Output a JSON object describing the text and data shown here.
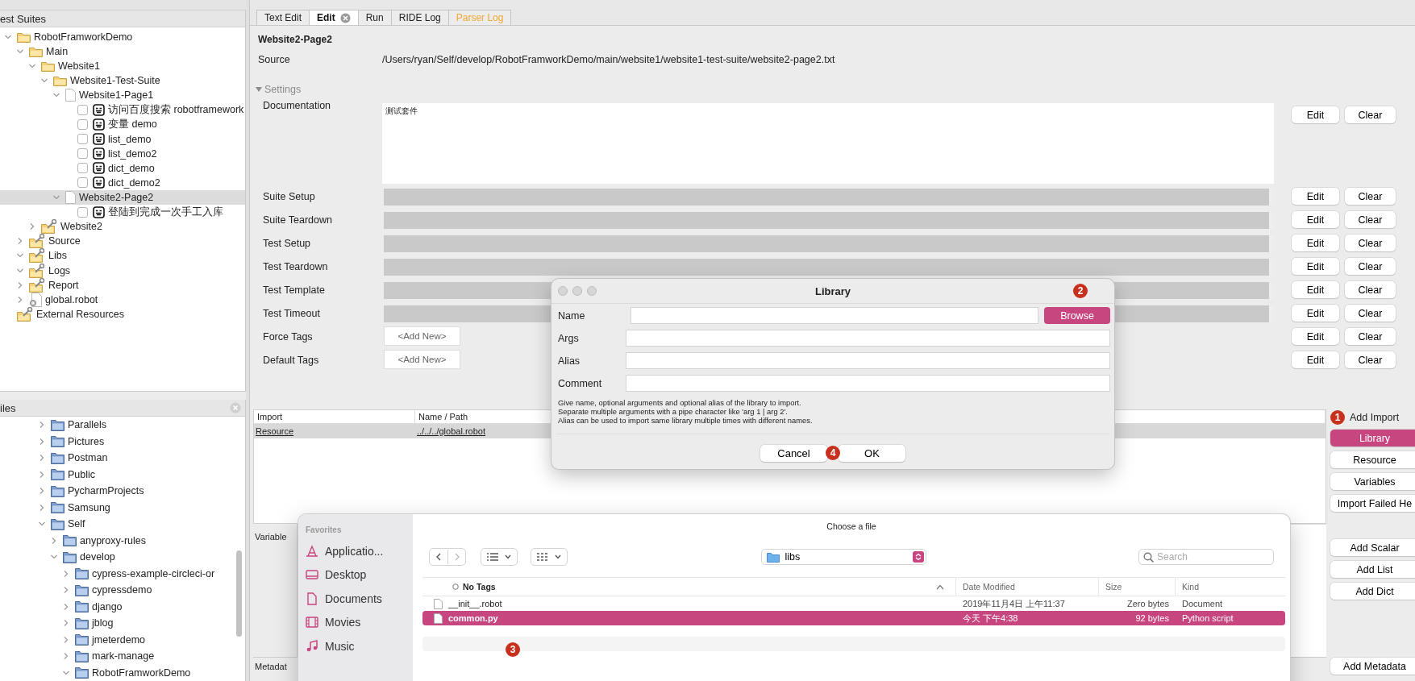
{
  "test_suites": {
    "title": "est Suites",
    "tree": [
      {
        "label": "RobotFramworkDemo",
        "kind": "suite-folder",
        "expanded": true,
        "selected": false,
        "children": [
          {
            "label": "Main",
            "kind": "suite-folder",
            "expanded": true,
            "selected": false,
            "children": [
              {
                "label": "Website1",
                "kind": "suite-folder",
                "expanded": true,
                "selected": false,
                "children": [
                  {
                    "label": "Website1-Test-Suite",
                    "kind": "suite-folder",
                    "expanded": true,
                    "selected": false,
                    "children": [
                      {
                        "label": "Website1-Page1",
                        "kind": "suite-file",
                        "expanded": true,
                        "selected": false,
                        "children": [
                          {
                            "label": "访问百度搜索 robotframework",
                            "kind": "test",
                            "checked": false,
                            "selected": false
                          },
                          {
                            "label": "变量 demo",
                            "kind": "test",
                            "checked": false,
                            "selected": false
                          },
                          {
                            "label": "list_demo",
                            "kind": "test",
                            "checked": false,
                            "selected": false
                          },
                          {
                            "label": "list_demo2",
                            "kind": "test",
                            "checked": false,
                            "selected": false
                          },
                          {
                            "label": "dict_demo",
                            "kind": "test",
                            "checked": false,
                            "selected": false
                          },
                          {
                            "label": "dict_demo2",
                            "kind": "test",
                            "checked": false,
                            "selected": false
                          }
                        ]
                      },
                      {
                        "label": "Website2-Page2",
                        "kind": "suite-file",
                        "expanded": true,
                        "selected": true,
                        "children": [
                          {
                            "label": "登陆到完成一次手工入库",
                            "kind": "test",
                            "checked": false,
                            "selected": false
                          }
                        ]
                      }
                    ]
                  }
                ]
              },
              {
                "label": "Website2",
                "kind": "resource-folder",
                "expanded": false,
                "selected": false
              }
            ]
          },
          {
            "label": "Source",
            "kind": "resource-folder",
            "expanded": false,
            "selected": false
          },
          {
            "label": "Libs",
            "kind": "resource-folder",
            "expanded": true,
            "selected": false
          },
          {
            "label": "Logs",
            "kind": "resource-folder",
            "expanded": true,
            "selected": false
          },
          {
            "label": "Report",
            "kind": "resource-folder",
            "expanded": false,
            "selected": false
          },
          {
            "label": "global.robot",
            "kind": "resource-file",
            "expanded": false,
            "selected": false
          }
        ]
      },
      {
        "label": "External Resources",
        "kind": "resource-folder",
        "selected": false
      }
    ]
  },
  "files": {
    "title": "iles",
    "tree": [
      {
        "label": "Parallels",
        "kind": "folder",
        "expanded": false
      },
      {
        "label": "Pictures",
        "kind": "folder",
        "expanded": false
      },
      {
        "label": "Postman",
        "kind": "folder",
        "expanded": false
      },
      {
        "label": "Public",
        "kind": "folder",
        "expanded": false
      },
      {
        "label": "PycharmProjects",
        "kind": "folder",
        "expanded": false
      },
      {
        "label": "Samsung",
        "kind": "folder",
        "expanded": false
      },
      {
        "label": "Self",
        "kind": "folder",
        "expanded": true,
        "children": [
          {
            "label": "anyproxy-rules",
            "kind": "folder",
            "expanded": false
          },
          {
            "label": "develop",
            "kind": "folder",
            "expanded": true,
            "children": [
              {
                "label": "cypress-example-circleci-or",
                "kind": "folder",
                "expanded": false
              },
              {
                "label": "cypressdemo",
                "kind": "folder",
                "expanded": false
              },
              {
                "label": "django",
                "kind": "folder",
                "expanded": false
              },
              {
                "label": "jblog",
                "kind": "folder",
                "expanded": false
              },
              {
                "label": "jmeterdemo",
                "kind": "folder",
                "expanded": false
              },
              {
                "label": "mark-manage",
                "kind": "folder",
                "expanded": false
              },
              {
                "label": "RobotFramworkDemo",
                "kind": "folder",
                "expanded": true
              }
            ]
          }
        ]
      }
    ]
  },
  "editor": {
    "tabs": [
      {
        "label": "Text Edit",
        "selected": false,
        "closable": false,
        "color": "#222222"
      },
      {
        "label": "Edit",
        "selected": true,
        "closable": true,
        "color": "#111111"
      },
      {
        "label": "Run",
        "selected": false,
        "closable": false,
        "color": "#222222"
      },
      {
        "label": "RIDE Log",
        "selected": false,
        "closable": false,
        "color": "#222222"
      },
      {
        "label": "Parser Log",
        "selected": false,
        "closable": false,
        "color": "#f0a830"
      }
    ],
    "title": "Website2-Page2",
    "source": {
      "label": "Source",
      "value": "/Users/ryan/Self/develop/RobotFramworkDemo/main/website1/website1-test-suite/website2-page2.txt"
    },
    "settings": {
      "label": "Settings",
      "expanded": true,
      "rows": [
        {
          "label": "Documentation",
          "kind": "text",
          "value": "测试套件",
          "buttons": [
            "Edit",
            "Clear"
          ]
        },
        {
          "label": "Suite Setup",
          "kind": "field",
          "buttons": [
            "Edit",
            "Clear"
          ]
        },
        {
          "label": "Suite Teardown",
          "kind": "field",
          "buttons": [
            "Edit",
            "Clear"
          ]
        },
        {
          "label": "Test Setup",
          "kind": "field",
          "buttons": [
            "Edit",
            "Clear"
          ]
        },
        {
          "label": "Test Teardown",
          "kind": "field",
          "buttons": [
            "Edit",
            "Clear"
          ]
        },
        {
          "label": "Test Template",
          "kind": "field",
          "buttons": [
            "Edit",
            "Clear"
          ]
        },
        {
          "label": "Test Timeout",
          "kind": "field",
          "buttons": [
            "Edit",
            "Clear"
          ]
        },
        {
          "label": "Force Tags",
          "kind": "tags",
          "add_label": "<Add New>",
          "buttons": [
            "Edit",
            "Clear"
          ]
        },
        {
          "label": "Default Tags",
          "kind": "tags",
          "add_label": "<Add New>",
          "buttons": [
            "Edit",
            "Clear"
          ]
        }
      ]
    },
    "imports": {
      "columns": [
        "Import",
        "Name / Path"
      ],
      "rows": [
        {
          "cells": [
            "Resource",
            "../../../global.robot"
          ],
          "selected": true
        }
      ]
    },
    "variables": {
      "label": "Variable"
    },
    "metadata": {
      "label": "Metadat"
    }
  },
  "side_actions": {
    "import_title": "Add Import",
    "import_marker": "1",
    "import_buttons": [
      {
        "label": "Library",
        "highlighted": true
      },
      {
        "label": "Resource",
        "highlighted": false
      },
      {
        "label": "Variables",
        "highlighted": false
      },
      {
        "label": "Import Failed He",
        "highlighted": false
      }
    ],
    "variable_buttons": [
      {
        "label": "Add Scalar",
        "highlighted": false
      },
      {
        "label": "Add List",
        "highlighted": false
      },
      {
        "label": "Add Dict",
        "highlighted": false
      }
    ],
    "metadata_buttons": [
      {
        "label": "Add Metadata",
        "highlighted": false
      }
    ]
  },
  "library_dialog": {
    "title": "Library",
    "marker": "2",
    "fields": [
      {
        "label": "Name",
        "browse": {
          "label": "Browse",
          "highlighted": true
        }
      },
      {
        "label": "Args"
      },
      {
        "label": "Alias"
      },
      {
        "label": "Comment"
      }
    ],
    "help": [
      "Give name, optional arguments and optional alias of the library to import.",
      "Separate multiple arguments with a pipe character like 'arg 1 | arg 2'.",
      "Alias can be used to import same library multiple times with different names."
    ],
    "buttons": [
      {
        "label": "Cancel"
      },
      {
        "label": "OK",
        "marker": "4"
      }
    ]
  },
  "file_chooser": {
    "title": "Choose a file",
    "sidebar": {
      "title": "Favorites",
      "items": [
        {
          "label": "Applicatio...",
          "kind": "apps"
        },
        {
          "label": "Desktop",
          "kind": "desktop"
        },
        {
          "label": "Documents",
          "kind": "documents"
        },
        {
          "label": "Movies",
          "kind": "movies"
        },
        {
          "label": "Music",
          "kind": "music"
        }
      ]
    },
    "location": "libs",
    "search": {
      "placeholder": "Search"
    },
    "columns": [
      "No Tags",
      "Date Modified",
      "Size",
      "Kind"
    ],
    "files": [
      {
        "name": "__init__.robot",
        "date": "2019年11月4日 上午11:37",
        "size": "Zero bytes",
        "kind": "Document",
        "selected": false
      },
      {
        "name": "common.py",
        "date": "今天 下午4:38",
        "size": "92 bytes",
        "kind": "Python script",
        "selected": true,
        "marker": "3"
      }
    ]
  }
}
